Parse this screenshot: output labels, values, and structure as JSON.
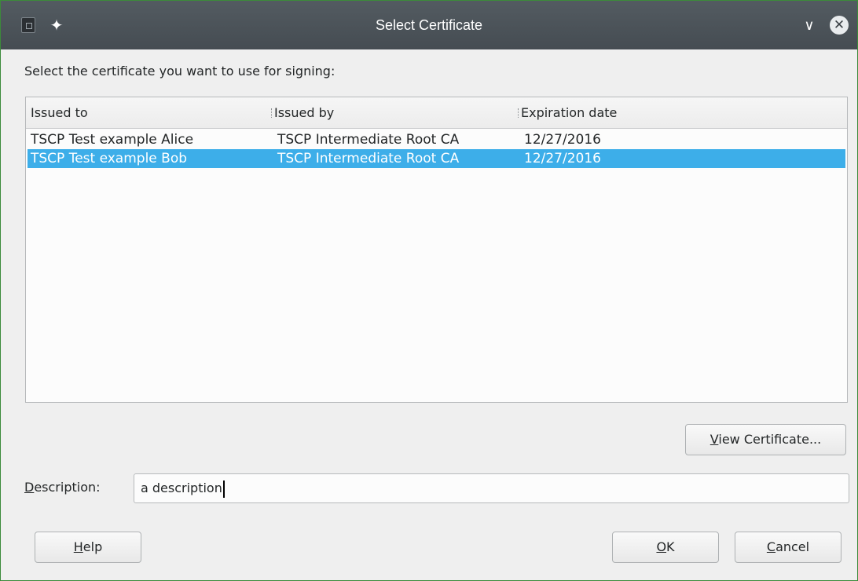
{
  "window": {
    "title": "Select Certificate",
    "pin_glyph": "✦",
    "minimize_glyph": "∨",
    "close_glyph": "✕"
  },
  "prompt": "Select the certificate you want to use for signing:",
  "certificate_list": {
    "columns": [
      "Issued to",
      "Issued by",
      "Expiration date"
    ],
    "rows": [
      {
        "issued_to": "TSCP Test example Alice",
        "issued_by": "TSCP Intermediate Root CA",
        "expiration": "12/27/2016",
        "selected": false
      },
      {
        "issued_to": "TSCP Test example Bob",
        "issued_by": "TSCP Intermediate Root CA",
        "expiration": "12/27/2016",
        "selected": true
      }
    ],
    "selection_color": "#3daee9"
  },
  "buttons": {
    "view_certificate": {
      "mnemonic": "V",
      "rest": "iew Certificate..."
    },
    "help": {
      "mnemonic": "H",
      "rest": "elp"
    },
    "ok": {
      "mnemonic": "O",
      "rest": "K"
    },
    "cancel": {
      "mnemonic": "C",
      "rest": "ancel"
    }
  },
  "description": {
    "label_mnemonic": "D",
    "label_rest": "escription:",
    "value": "a description"
  },
  "icons": {
    "app": "app-icon",
    "pin": "pin-icon",
    "minimize": "chevron-down-icon",
    "close": "close-icon"
  }
}
